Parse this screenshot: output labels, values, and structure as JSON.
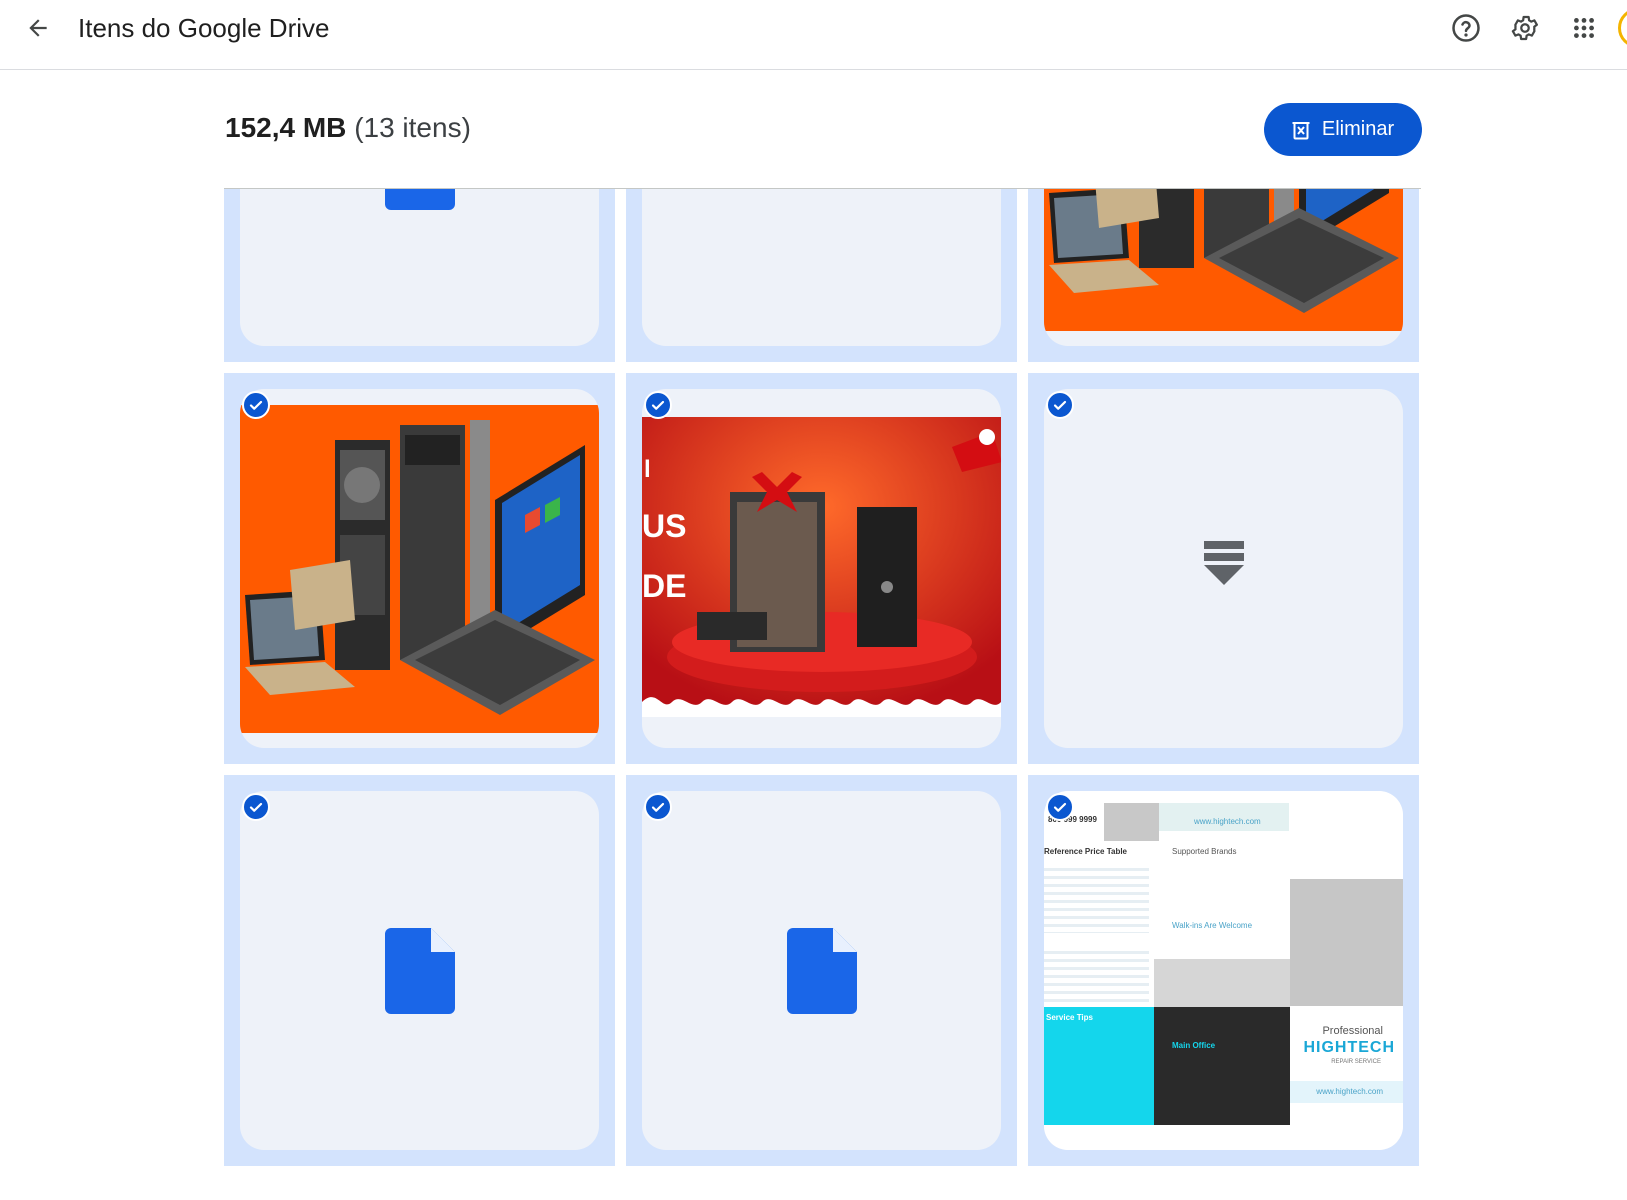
{
  "header": {
    "title": "Itens do Google Drive",
    "help_icon": "help-circle-icon",
    "settings_icon": "gear-icon",
    "apps_icon": "apps-grid-icon"
  },
  "summary": {
    "size": "152,4 MB",
    "count": "(13 itens)"
  },
  "actions": {
    "delete_label": "Eliminar"
  },
  "colors": {
    "accent": "#0b57d0",
    "tile_selected_bg": "#d3e3fd",
    "tile_inner_bg": "#eef2f9",
    "file_icon": "#1a66e8",
    "promo_orange": "#ff5a00",
    "promo_red": "#c8121a"
  },
  "items": [
    {
      "type": "file",
      "selected": true
    },
    {
      "type": "video",
      "selected": true
    },
    {
      "type": "image-laptops",
      "selected": true
    },
    {
      "type": "image-laptops",
      "selected": true
    },
    {
      "type": "image-christmas",
      "selected": true
    },
    {
      "type": "video",
      "selected": true
    },
    {
      "type": "file",
      "selected": true
    },
    {
      "type": "file",
      "selected": true
    },
    {
      "type": "image-flyer",
      "selected": true
    }
  ],
  "christmas_poster": {
    "letters_1": "l",
    "letters_2": "US",
    "letters_3": "DE"
  },
  "flyer": {
    "phone": "800 999 9999",
    "website_top": "www.hightech.com",
    "price_table": "Reference Price Table",
    "brands": "Supported Brands",
    "tips": "Service Tips",
    "main_office": "Main Office",
    "welcome": "Walk-ins Are Welcome",
    "professional": "Professional",
    "hightech": "HIGHTECH",
    "repair": "REPAIR SERVICE",
    "website": "www.hightech.com"
  }
}
